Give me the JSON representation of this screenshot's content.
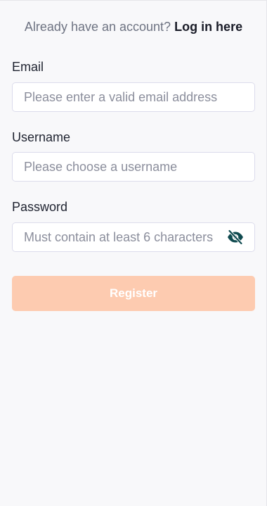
{
  "login_prompt": {
    "text": "Already have an account?",
    "link_label": "Log in here"
  },
  "fields": {
    "email": {
      "label": "Email",
      "placeholder": "Please enter a valid email address",
      "value": ""
    },
    "username": {
      "label": "Username",
      "placeholder": "Please choose a username",
      "value": ""
    },
    "password": {
      "label": "Password",
      "placeholder": "Must contain at least 6 characters",
      "value": "",
      "toggle_icon": "eye-off-icon"
    }
  },
  "register_button": {
    "label": "Register"
  },
  "colors": {
    "accent": "#fdcbb0",
    "eye_icon": "#0f4a4f",
    "background": "#f8f8fa"
  }
}
